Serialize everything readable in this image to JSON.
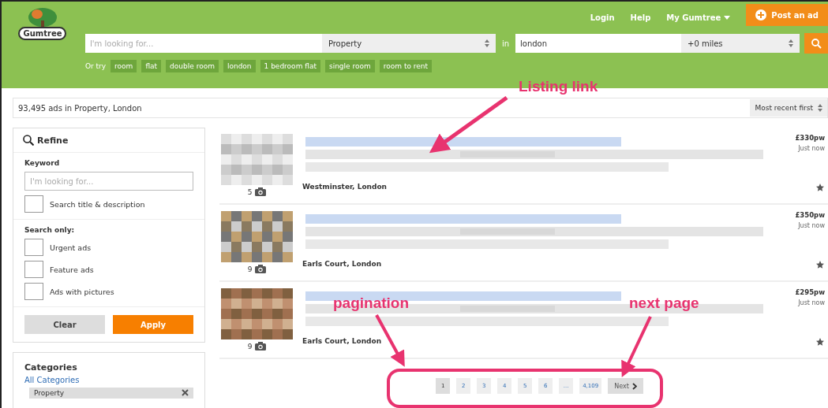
{
  "header": {
    "logo": "Gumtree",
    "nav": [
      {
        "label": "Login",
        "kind": "link"
      },
      {
        "label": "Help",
        "kind": "link"
      },
      {
        "label": "My Gumtree",
        "kind": "menu"
      }
    ],
    "post_button": "Post an ad",
    "search": {
      "placeholder": "I'm looking for...",
      "category": "Property",
      "in_label": "in",
      "location": "london",
      "distance": "+0 miles"
    },
    "or_try": {
      "label": "Or try",
      "chips": [
        "room",
        "flat",
        "double room",
        "london",
        "1 bedroom flat",
        "single room",
        "room to rent"
      ]
    }
  },
  "results_bar": {
    "count": "93,495 ads in Property, London",
    "sort": "Most recent first"
  },
  "refine": {
    "title": "Refine",
    "keyword_label": "Keyword",
    "keyword_placeholder": "I'm looking for...",
    "title_desc": {
      "label": "Search title & description",
      "checked": false
    },
    "search_only_label": "Search only:",
    "options": [
      {
        "label": "Urgent ads",
        "checked": false
      },
      {
        "label": "Feature ads",
        "checked": false
      },
      {
        "label": "Ads with pictures",
        "checked": false
      }
    ],
    "clear": "Clear",
    "apply": "Apply"
  },
  "categories": {
    "title": "Categories",
    "all": "All Categories",
    "current": "Property"
  },
  "listings": [
    {
      "photos": "5",
      "location": "Westminster, London",
      "price": "£330pw",
      "time": "Just now"
    },
    {
      "photos": "9",
      "location": "Earls Court, London",
      "price": "£350pw",
      "time": "Just now"
    },
    {
      "photos": "9",
      "location": "Earls Court, London",
      "price": "£295pw",
      "time": "Just now"
    }
  ],
  "pagination": {
    "pages": [
      {
        "label": "1",
        "selected": true
      },
      {
        "label": "2",
        "selected": false
      },
      {
        "label": "3",
        "selected": false
      },
      {
        "label": "4",
        "selected": false
      },
      {
        "label": "5",
        "selected": false
      },
      {
        "label": "6",
        "selected": false
      },
      {
        "label": "...",
        "selected": false
      },
      {
        "label": "4,109",
        "selected": false
      }
    ],
    "next": "Next"
  },
  "annotations": [
    {
      "text": "Listing link"
    },
    {
      "text": "pagination"
    },
    {
      "text": "next page"
    }
  ]
}
